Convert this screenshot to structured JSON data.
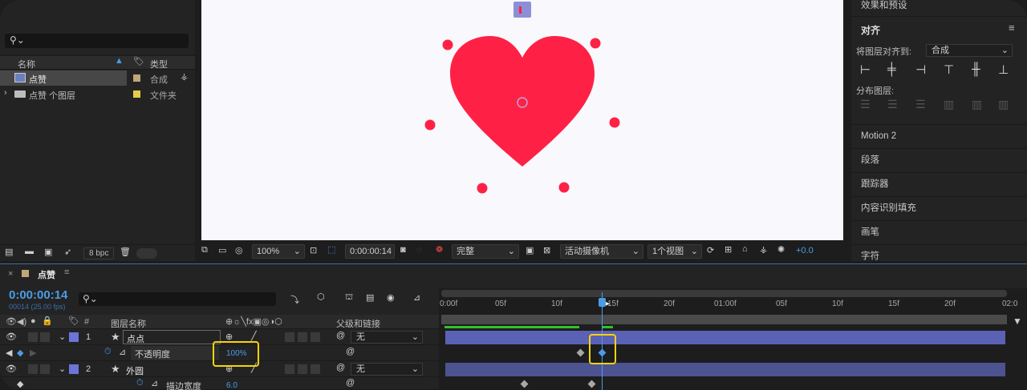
{
  "project": {
    "columns": {
      "name": "名称",
      "type": "类型"
    },
    "items": [
      {
        "name": "点赞",
        "type": "合成",
        "color": "#bfa77a"
      },
      {
        "name": "点赞 个图层",
        "type": "文件夹",
        "color": "#e4cd4a"
      }
    ],
    "footer": {
      "bpc": "8 bpc"
    }
  },
  "viewer": {
    "zoom": "100%",
    "timecode": "0:00:00:14",
    "resolution": "完整",
    "camera": "活动摄像机",
    "views": "1个视图",
    "exposure": "+0.0"
  },
  "right_panel": {
    "effects_presets": "效果和预设",
    "align": {
      "title": "对齐",
      "align_to_label": "将图层对齐到:",
      "align_to_value": "合成",
      "distribute_label": "分布图层:"
    },
    "items": [
      "Motion 2",
      "段落",
      "跟踪器",
      "内容识别填充",
      "画笔",
      "字符"
    ]
  },
  "timeline": {
    "comp_name": "点赞",
    "timecode": "0:00:00:14",
    "fps_info": "00014 (25.00 fps)",
    "columns": {
      "num": "#",
      "layer_name": "图层名称",
      "parent": "父级和链接"
    },
    "ruler": [
      "0:00f",
      "05f",
      "10f",
      "15f",
      "20f",
      "01:00f",
      "05f",
      "10f",
      "15f",
      "20f",
      "02:0"
    ],
    "layers": [
      {
        "num": "1",
        "name": "点点",
        "parent": "无"
      },
      {
        "property": "不透明度",
        "value": "100%"
      },
      {
        "num": "2",
        "name": "外圆",
        "parent": "无"
      },
      {
        "property": "描边宽度",
        "value": "6.0"
      }
    ]
  },
  "colors": {
    "heart": "#ff2145",
    "accent_blue": "#2d8ceb",
    "highlight": "#f5d40a",
    "layer_label": "#6a75d8"
  }
}
